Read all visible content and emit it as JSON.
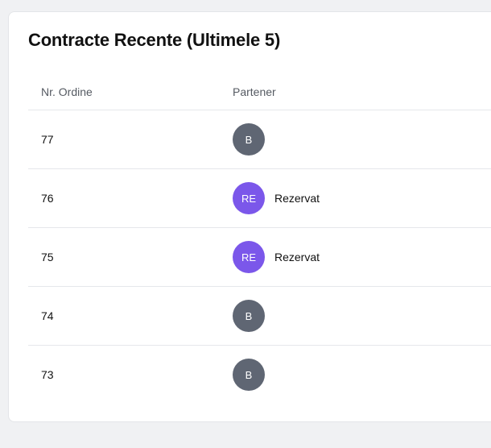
{
  "card": {
    "title": "Contracte Recente (Ultimele 5)"
  },
  "table": {
    "headers": {
      "order": "Nr. Ordine",
      "partner": "Partener"
    },
    "rows": [
      {
        "order": "77",
        "avatar": "B",
        "avatar_color": "#5f6673",
        "partner": ""
      },
      {
        "order": "76",
        "avatar": "RE",
        "avatar_color": "#7b57ea",
        "partner": "Rezervat"
      },
      {
        "order": "75",
        "avatar": "RE",
        "avatar_color": "#7b57ea",
        "partner": "Rezervat"
      },
      {
        "order": "74",
        "avatar": "B",
        "avatar_color": "#5f6673",
        "partner": ""
      },
      {
        "order": "73",
        "avatar": "B",
        "avatar_color": "#5f6673",
        "partner": ""
      }
    ]
  }
}
